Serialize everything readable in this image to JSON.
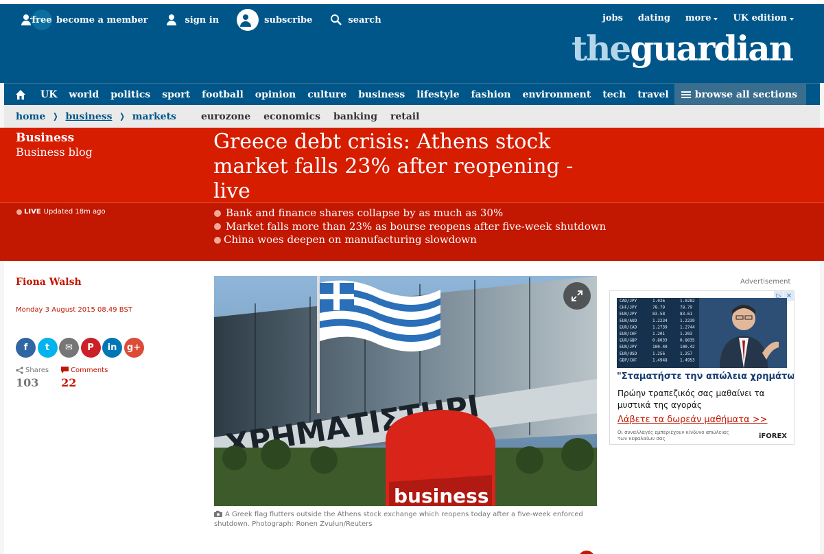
{
  "utility": {
    "free_label": "free",
    "member_label": "become a member",
    "signin_label": "sign in",
    "subscribe_label": "subscribe",
    "search_label": "search",
    "right": {
      "jobs": "jobs",
      "dating": "dating",
      "more": "more",
      "edition": "UK edition"
    }
  },
  "logo": {
    "the": "the",
    "guardian": "guardian"
  },
  "nav": {
    "items": [
      "UK",
      "world",
      "politics",
      "sport",
      "football",
      "opinion",
      "culture",
      "business",
      "lifestyle",
      "fashion",
      "environment",
      "tech",
      "travel"
    ],
    "browse_label": "browse all sections"
  },
  "breadcrumb": {
    "home": "home",
    "business": "business",
    "markets": "markets",
    "subnav": [
      "eurozone",
      "economics",
      "banking",
      "retail"
    ]
  },
  "article": {
    "section": "Business",
    "series": "Business blog",
    "headline": "Greece debt crisis: Athens stock market falls 23% after reopening - live",
    "live_label": "LIVE",
    "updated": "Updated 18m ago",
    "bullets": [
      "Bank and finance shares collapse by as much as 30%",
      "Market falls more than 23% as bourse reopens after five-week shutdown",
      "China woes deepen on manufacturing slowdown"
    ],
    "author": "Fiona Walsh",
    "date": "Monday 3 August 2015 08.49 BST",
    "shares_label": "Shares",
    "shares_count": "103",
    "comments_label": "Comments",
    "comments_count": "22",
    "photo_sign": "business",
    "caption": "A Greek flag flutters outside the Athens stock exchange which reopens today after a five-week enforced shutdown. Photograph: Ronen Zvulun/Reuters"
  },
  "share_buttons": [
    {
      "name": "facebook",
      "glyph": "f",
      "color": "#3067a3"
    },
    {
      "name": "twitter",
      "glyph": "t",
      "color": "#03b3ee"
    },
    {
      "name": "email",
      "glyph": "✉",
      "color": "#767676"
    },
    {
      "name": "pinterest",
      "glyph": "P",
      "color": "#cb2027"
    },
    {
      "name": "linkedin",
      "glyph": "in",
      "color": "#0077b5"
    },
    {
      "name": "googleplus",
      "glyph": "g+",
      "color": "#dd4b39"
    }
  ],
  "ad": {
    "label": "Advertisement",
    "ticker": [
      [
        "CAD/JPY",
        "1.026",
        "1.0282"
      ],
      [
        "CHF/JPY",
        "78.79",
        "78.79"
      ],
      [
        "EUR/JPY",
        "83.58",
        "83.61"
      ],
      [
        "EUR/AUD",
        "1.2234",
        "1.2239"
      ],
      [
        "EUR/CAD",
        "1.2739",
        "1.2744"
      ],
      [
        "EUR/CHF",
        "1.201",
        "1.203"
      ],
      [
        "EUR/GBP",
        "0.8033",
        "0.8035"
      ],
      [
        "EUR/JPY",
        "100.40",
        "100.42"
      ],
      [
        "EUR/USD",
        "1.256",
        "1.257"
      ],
      [
        "GBP/CHF",
        "1.4948",
        "1.4953"
      ]
    ],
    "headline": "\"Σταματήστε την απώλεια χρημάτων\"",
    "text": "Πρώην τραπεζικός σας μαθαίνει τα μυστικά της αγοράς",
    "cta": "Λάβετε τα δωρεάν μαθήματα >>",
    "fine": "Οι συναλλαγές εμπεριέχουν κίνδυνο απώλειας των κεφαλαίων σας",
    "brand": "iFOREX",
    "adchoices": "▷",
    "close": "✕"
  },
  "colors": {
    "brand_blue": "#005689",
    "live_red": "#d61d00",
    "live_red_dark": "#c21700"
  }
}
